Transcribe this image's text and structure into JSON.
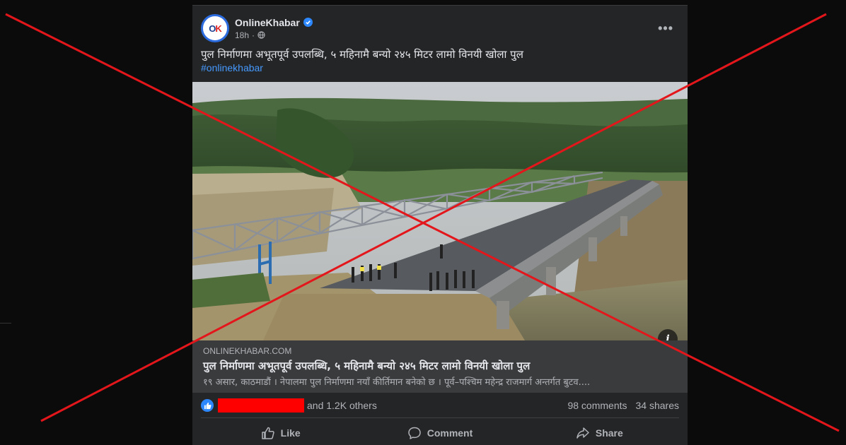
{
  "post": {
    "page_name": "OnlineKhabar",
    "avatar_text": "OK",
    "time": "18h",
    "caption": "पुल निर्माणमा अभूतपूर्व उपलब्धि, ५ महिनामै बन्यो २४५ मिटर लामो विनयी खोला पुल",
    "hashtag": "#onlinekhabar",
    "more_label": "•••"
  },
  "link_preview": {
    "domain": "ONLINEKHABAR.COM",
    "title": "पुल निर्माणमा अभूतपूर्व उपलब्धि, ५ महिनामै बन्यो २४५ मिटर लामो विनयी खोला पुल",
    "description": "१९ असार, काठमाडौं । नेपालमा पुल निर्माणमा नयाँ कीर्तिमान बनेको छ । पूर्व–पश्चिम महेन्द्र राजमार्ग अन्तर्गत बुटव...."
  },
  "stats": {
    "reactors": "and 1.2K others",
    "comments": "98 comments",
    "shares": "34 shares"
  },
  "actions": {
    "like": "Like",
    "comment": "Comment",
    "share": "Share"
  },
  "icons": {
    "verified": "verified-badge-icon",
    "globe": "globe-icon",
    "info": "info-icon",
    "like": "thumbs-up-icon",
    "comment": "speech-bubble-icon",
    "share": "share-arrow-icon"
  },
  "colors": {
    "overlay_x": "#e3161b",
    "accent": "#2d88ff",
    "hashtag": "#4599ff",
    "redaction": "#ff0000"
  }
}
